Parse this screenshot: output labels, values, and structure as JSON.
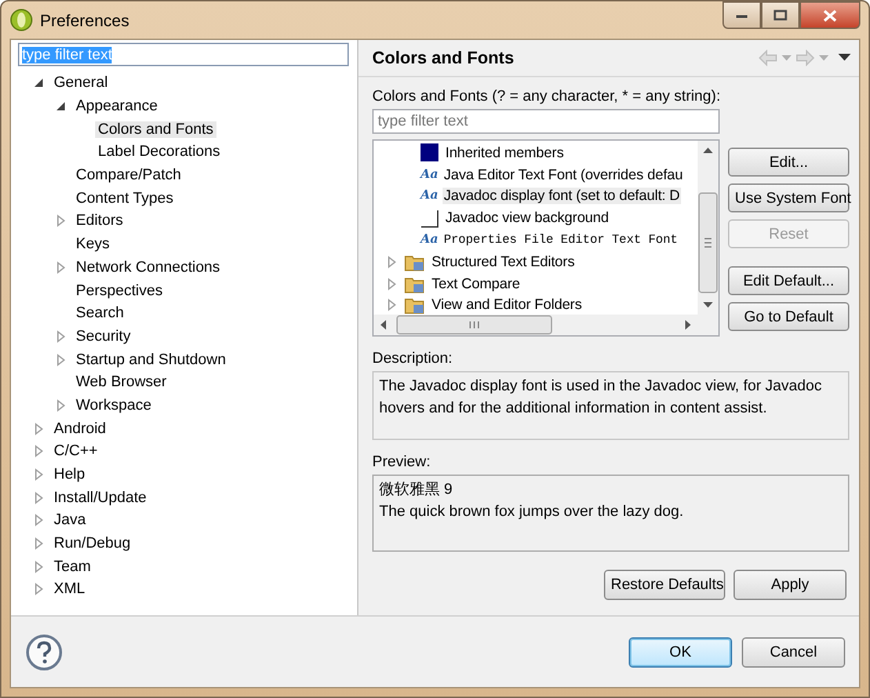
{
  "window": {
    "title": "Preferences"
  },
  "filter": {
    "value": "type filter text",
    "text_selected": true
  },
  "tree": [
    {
      "label": "General",
      "expanded": true,
      "selected": false,
      "children": [
        {
          "label": "Appearance",
          "expanded": true,
          "selected": false,
          "children": [
            {
              "label": "Colors and Fonts",
              "selected": true
            },
            {
              "label": "Label Decorations",
              "selected": false
            }
          ]
        },
        {
          "label": "Compare/Patch",
          "selected": false
        },
        {
          "label": "Content Types",
          "selected": false
        },
        {
          "label": "Editors",
          "expanded": false,
          "selected": false
        },
        {
          "label": "Keys",
          "selected": false
        },
        {
          "label": "Network Connections",
          "expanded": false,
          "selected": false
        },
        {
          "label": "Perspectives",
          "selected": false
        },
        {
          "label": "Search",
          "selected": false
        },
        {
          "label": "Security",
          "expanded": false,
          "selected": false
        },
        {
          "label": "Startup and Shutdown",
          "expanded": false,
          "selected": false
        },
        {
          "label": "Web Browser",
          "selected": false
        },
        {
          "label": "Workspace",
          "expanded": false,
          "selected": false
        }
      ]
    },
    {
      "label": "Android",
      "expanded": false,
      "selected": false
    },
    {
      "label": "C/C++",
      "expanded": false,
      "selected": false
    },
    {
      "label": "Help",
      "expanded": false,
      "selected": false
    },
    {
      "label": "Install/Update",
      "expanded": false,
      "selected": false
    },
    {
      "label": "Java",
      "expanded": false,
      "selected": false
    },
    {
      "label": "Run/Debug",
      "expanded": false,
      "selected": false
    },
    {
      "label": "Team",
      "expanded": false,
      "selected": false
    },
    {
      "label": "XML",
      "expanded": false,
      "selected": false
    }
  ],
  "page": {
    "title": "Colors and Fonts",
    "filter_label": "Colors and Fonts (? = any character, * = any string):",
    "filter": {
      "placeholder": "type filter text"
    },
    "items": [
      {
        "kind": "color",
        "label": "Inherited members",
        "color": "#000080",
        "selected": false
      },
      {
        "kind": "font",
        "icon_text": "Aa",
        "label": "Java Editor Text Font (overrides defau",
        "selected": false
      },
      {
        "kind": "font",
        "icon_text": "Aa",
        "label": "Javadoc display font (set to default: D",
        "selected": true
      },
      {
        "kind": "color",
        "label": "Javadoc view background",
        "color": "#ffffff",
        "selected": false
      },
      {
        "kind": "monofont",
        "icon_text": "Aa",
        "label": "Properties File Editor Text Font",
        "selected": false
      },
      {
        "kind": "folder",
        "label": "Structured Text Editors",
        "expanded": false,
        "selected": false
      },
      {
        "kind": "folder",
        "label": "Text Compare",
        "expanded": false,
        "selected": false
      },
      {
        "kind": "folder",
        "label": "View and Editor Folders",
        "expanded": false,
        "selected": false
      }
    ],
    "side_buttons": [
      {
        "label": "Edit...",
        "disabled": false,
        "gap_before": false
      },
      {
        "label": "Use System Font",
        "disabled": false,
        "gap_before": false
      },
      {
        "label": "Reset",
        "disabled": true,
        "gap_before": false
      },
      {
        "label": "Edit Default...",
        "disabled": false,
        "gap_before": true
      },
      {
        "label": "Go to Default",
        "disabled": false,
        "gap_before": false
      }
    ],
    "description_label": "Description:",
    "description": "The Javadoc display font is used in the Javadoc view, for Javadoc hovers and for the additional information in content assist.",
    "preview_label": "Preview:",
    "preview": [
      "微软雅黑 9",
      "The quick brown fox jumps over the lazy dog."
    ],
    "page_buttons": [
      "Restore Defaults",
      "Apply"
    ]
  },
  "dialog_buttons": [
    {
      "label": "OK",
      "default": true
    },
    {
      "label": "Cancel",
      "default": false
    }
  ]
}
